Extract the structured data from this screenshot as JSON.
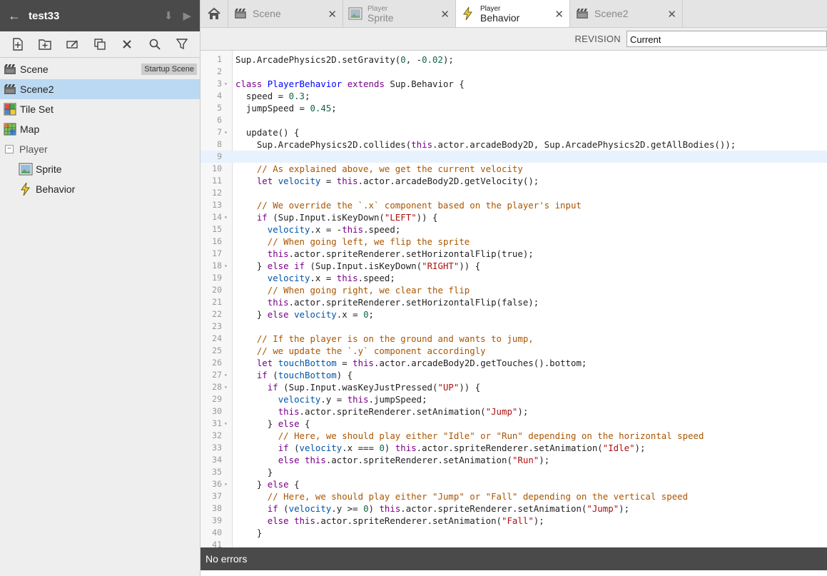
{
  "project": {
    "title": "test33"
  },
  "tree": [
    {
      "label": "Scene",
      "icon": "scene-icon",
      "badge": "Startup Scene"
    },
    {
      "label": "Scene2",
      "icon": "scene-icon"
    },
    {
      "label": "Tile Set",
      "icon": "tileset-icon"
    },
    {
      "label": "Map",
      "icon": "map-icon"
    },
    {
      "label": "Player",
      "icon": "folder-toggle"
    },
    {
      "label": "Sprite",
      "icon": "sprite-icon"
    },
    {
      "label": "Behavior",
      "icon": "behavior-icon"
    }
  ],
  "tabs": [
    {
      "label": "Scene"
    },
    {
      "sub": "Player",
      "label": "Sprite"
    },
    {
      "sub": "Player",
      "label": "Behavior"
    },
    {
      "label": "Scene2"
    }
  ],
  "revision": {
    "label": "REVISION",
    "value": "Current"
  },
  "status": "No errors",
  "code": [
    "Sup.ArcadePhysics2D.setGravity(0, -0.02);",
    "",
    "class PlayerBehavior extends Sup.Behavior {",
    "  speed = 0.3;",
    "  jumpSpeed = 0.45;",
    "",
    "  update() {",
    "    Sup.ArcadePhysics2D.collides(this.actor.arcadeBody2D, Sup.ArcadePhysics2D.getAllBodies());",
    "",
    "    // As explained above, we get the current velocity",
    "    let velocity = this.actor.arcadeBody2D.getVelocity();",
    "",
    "    // We override the `.x` component based on the player's input",
    "    if (Sup.Input.isKeyDown(\"LEFT\")) {",
    "      velocity.x = -this.speed;",
    "      // When going left, we flip the sprite",
    "      this.actor.spriteRenderer.setHorizontalFlip(true);",
    "    } else if (Sup.Input.isKeyDown(\"RIGHT\")) {",
    "      velocity.x = this.speed;",
    "      // When going right, we clear the flip",
    "      this.actor.spriteRenderer.setHorizontalFlip(false);",
    "    } else velocity.x = 0;",
    "",
    "    // If the player is on the ground and wants to jump,",
    "    // we update the `.y` component accordingly",
    "    let touchBottom = this.actor.arcadeBody2D.getTouches().bottom;",
    "    if (touchBottom) {",
    "      if (Sup.Input.wasKeyJustPressed(\"UP\")) {",
    "        velocity.y = this.jumpSpeed;",
    "        this.actor.spriteRenderer.setAnimation(\"Jump\");",
    "      } else {",
    "        // Here, we should play either \"Idle\" or \"Run\" depending on the horizontal speed",
    "        if (velocity.x === 0) this.actor.spriteRenderer.setAnimation(\"Idle\");",
    "        else this.actor.spriteRenderer.setAnimation(\"Run\");",
    "      }",
    "    } else {",
    "      // Here, we should play either \"Jump\" or \"Fall\" depending on the vertical speed",
    "      if (velocity.y >= 0) this.actor.spriteRenderer.setAnimation(\"Jump\");",
    "      else this.actor.spriteRenderer.setAnimation(\"Fall\");",
    "    }",
    ""
  ]
}
